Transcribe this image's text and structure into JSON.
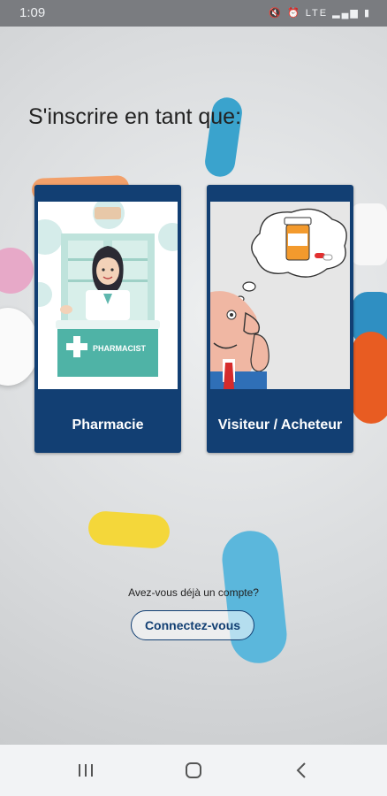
{
  "status_bar": {
    "time": "1:09",
    "icons": [
      "mute-icon",
      "alarm-icon",
      "lte-icon",
      "signal-icon",
      "battery-icon"
    ]
  },
  "page": {
    "heading": "S'inscrire en tant que:"
  },
  "cards": [
    {
      "label": "Pharmacie",
      "image_text": "PHARMACIST"
    },
    {
      "label": "Visiteur / Acheteur"
    }
  ],
  "account": {
    "question": "Avez-vous déjà un compte?",
    "login_label": "Connectez-vous"
  },
  "navbar": {
    "items": [
      "recent-apps-icon",
      "home-icon",
      "back-icon"
    ]
  },
  "colors": {
    "card": "#123f73",
    "accent_teal": "#3fa597"
  }
}
